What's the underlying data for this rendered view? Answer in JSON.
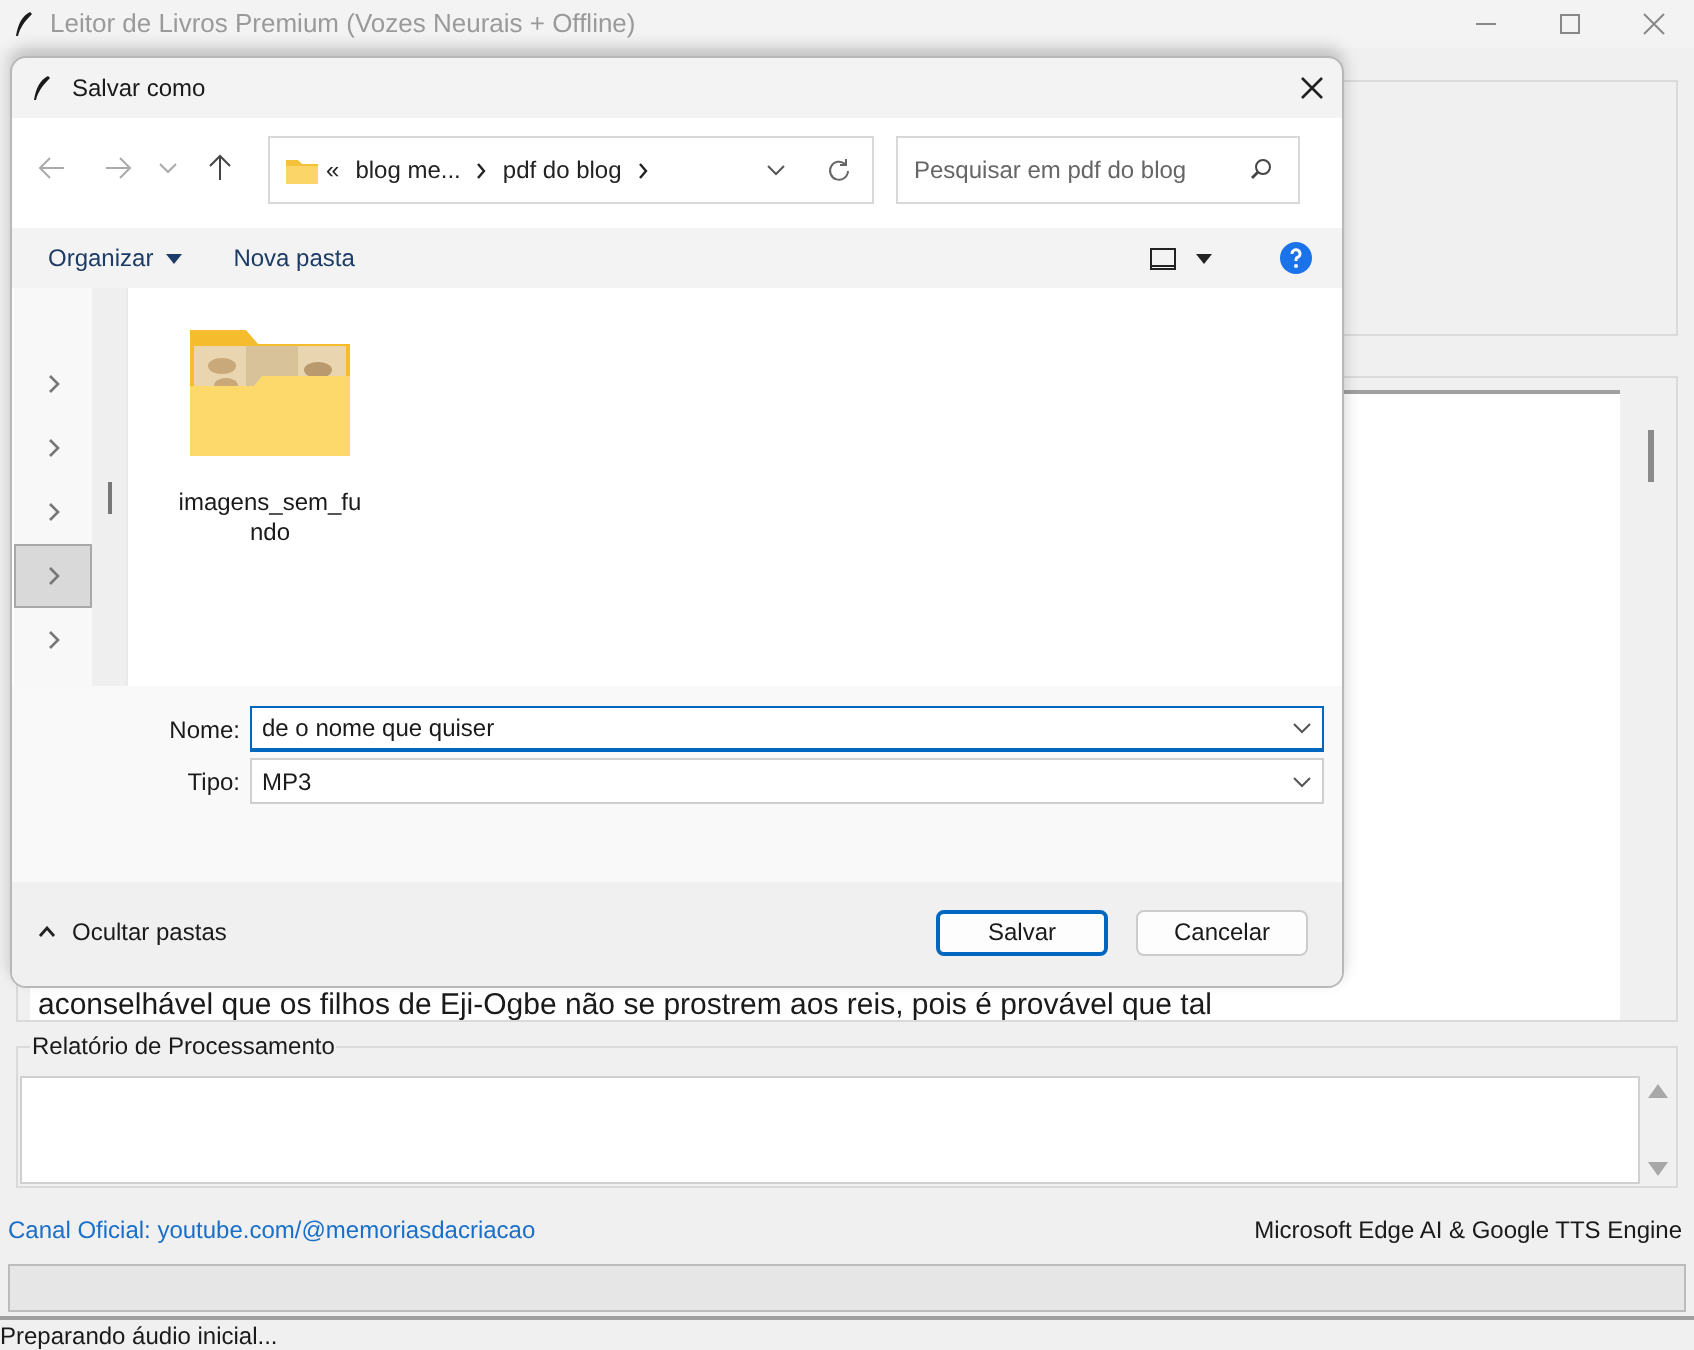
{
  "window": {
    "title": "Leitor de Livros Premium (Vozes Neurais + Offline)"
  },
  "text_area": {
    "visible_line": "aconselhável que os filhos de Eji-Ogbe não se prostrem aos reis, pois é provável que tal"
  },
  "report": {
    "label": "Relatório de Processamento"
  },
  "footer": {
    "link": "Canal Oficial: youtube.com/@memoriasdacriacao",
    "engine": "Microsoft Edge AI & Google TTS Engine"
  },
  "progress": {
    "level": 0
  },
  "status_bar": "Preparando áudio inicial...",
  "dialog": {
    "title": "Salvar como",
    "breadcrumb": [
      {
        "label": "«"
      },
      {
        "label": "blog me..."
      },
      {
        "label": "pdf do blog"
      }
    ],
    "search": {
      "placeholder": "Pesquisar em pdf do blog"
    },
    "commands": [
      "Organizar",
      "Nova pasta"
    ],
    "nav_items": [
      {
        "selected": false
      },
      {
        "selected": false
      },
      {
        "selected": false
      },
      {
        "selected": true
      },
      {
        "selected": false
      }
    ],
    "files": [
      {
        "name": "imagens_sem_fundo"
      }
    ],
    "fields": [
      {
        "label": "Nome:",
        "value": "de o nome que quiser",
        "focused": true
      },
      {
        "label": "Tipo:",
        "value": "MP3",
        "focused": false
      }
    ],
    "toggle": "Ocultar pastas",
    "buttons": [
      {
        "label": "Salvar",
        "default": true
      },
      {
        "label": "Cancelar",
        "default": false
      }
    ]
  }
}
